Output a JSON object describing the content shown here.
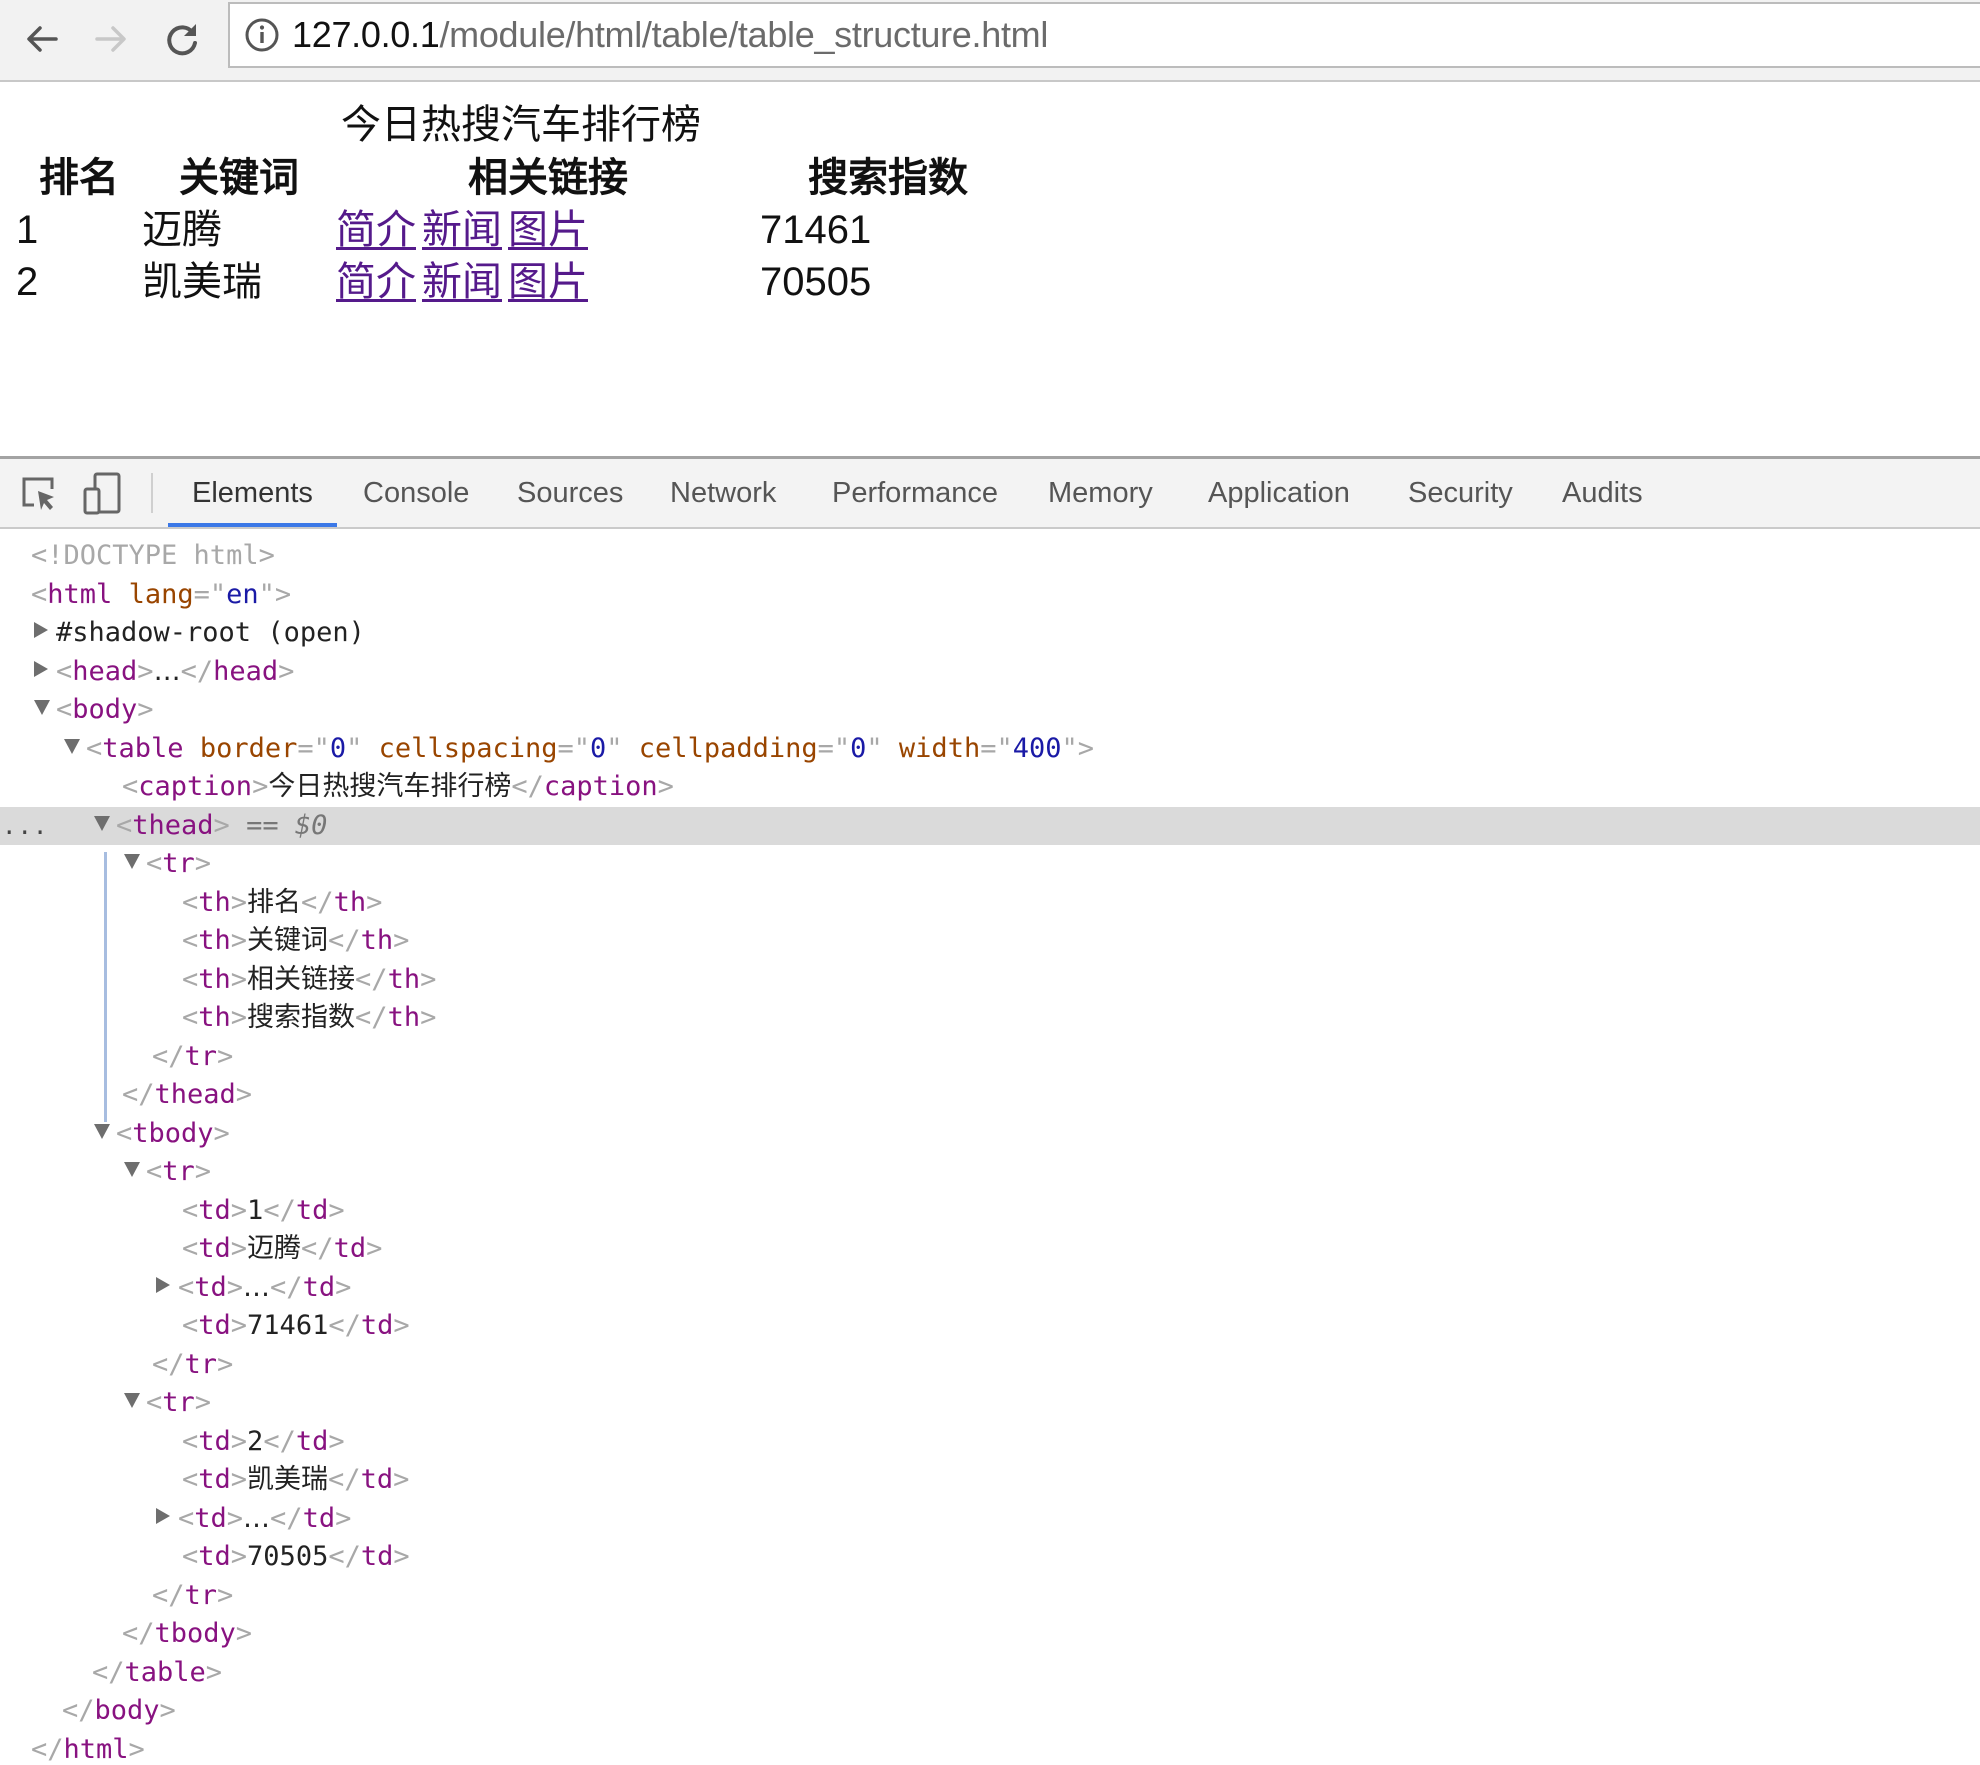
{
  "browser": {
    "back_icon": "arrow-left-icon",
    "forward_icon": "arrow-right-icon",
    "reload_icon": "reload-icon",
    "site_info_icon": "info-icon",
    "url_host": "127.0.0.1",
    "url_path": "/module/html/table/table_structure.html"
  },
  "page": {
    "caption": "今日热搜汽车排行榜",
    "headers": [
      "排名",
      "关键词",
      "相关链接",
      "搜索指数"
    ],
    "rows": [
      {
        "rank": "1",
        "keyword": "迈腾",
        "links": [
          "简介",
          "新闻",
          "图片"
        ],
        "index": "71461"
      },
      {
        "rank": "2",
        "keyword": "凯美瑞",
        "links": [
          "简介",
          "新闻",
          "图片"
        ],
        "index": "70505"
      }
    ],
    "link_color": "#551a8b"
  },
  "devtools": {
    "toolbar_icons": [
      "inspect-element-icon",
      "device-toolbar-icon"
    ],
    "tabs": [
      "Elements",
      "Console",
      "Sources",
      "Network",
      "Performance",
      "Memory",
      "Application",
      "Security",
      "Audits"
    ],
    "active_tab": "Elements",
    "selected_node_marker": "== $0",
    "more_dots": "...",
    "dom": {
      "doctype": "<!DOCTYPE html>",
      "html_tag": "html",
      "html_attr_name": "lang",
      "html_attr_value": "en",
      "shadow_root": "#shadow-root (open)",
      "head_tag": "head",
      "ellipsis": "…",
      "body_tag": "body",
      "table_tag": "table",
      "table_attrs": [
        {
          "name": "border",
          "value": "0"
        },
        {
          "name": "cellspacing",
          "value": "0"
        },
        {
          "name": "cellpadding",
          "value": "0"
        },
        {
          "name": "width",
          "value": "400"
        }
      ],
      "caption_tag": "caption",
      "caption_text": "今日热搜汽车排行榜",
      "thead_tag": "thead",
      "tbody_tag": "tbody",
      "tr_tag": "tr",
      "th_tag": "th",
      "td_tag": "td",
      "th_texts": [
        "排名",
        "关键词",
        "相关链接",
        "搜索指数"
      ],
      "row1_texts": [
        "1",
        "迈腾",
        "71461"
      ],
      "row2_texts": [
        "2",
        "凯美瑞",
        "70505"
      ]
    },
    "colors": {
      "tag": "#881280",
      "attr_name": "#994500",
      "attr_value": "#1a1aa6",
      "bracket": "#a8a8a8",
      "selected_row": "#dadada",
      "active_tab_underline": "#3b78e7"
    }
  }
}
